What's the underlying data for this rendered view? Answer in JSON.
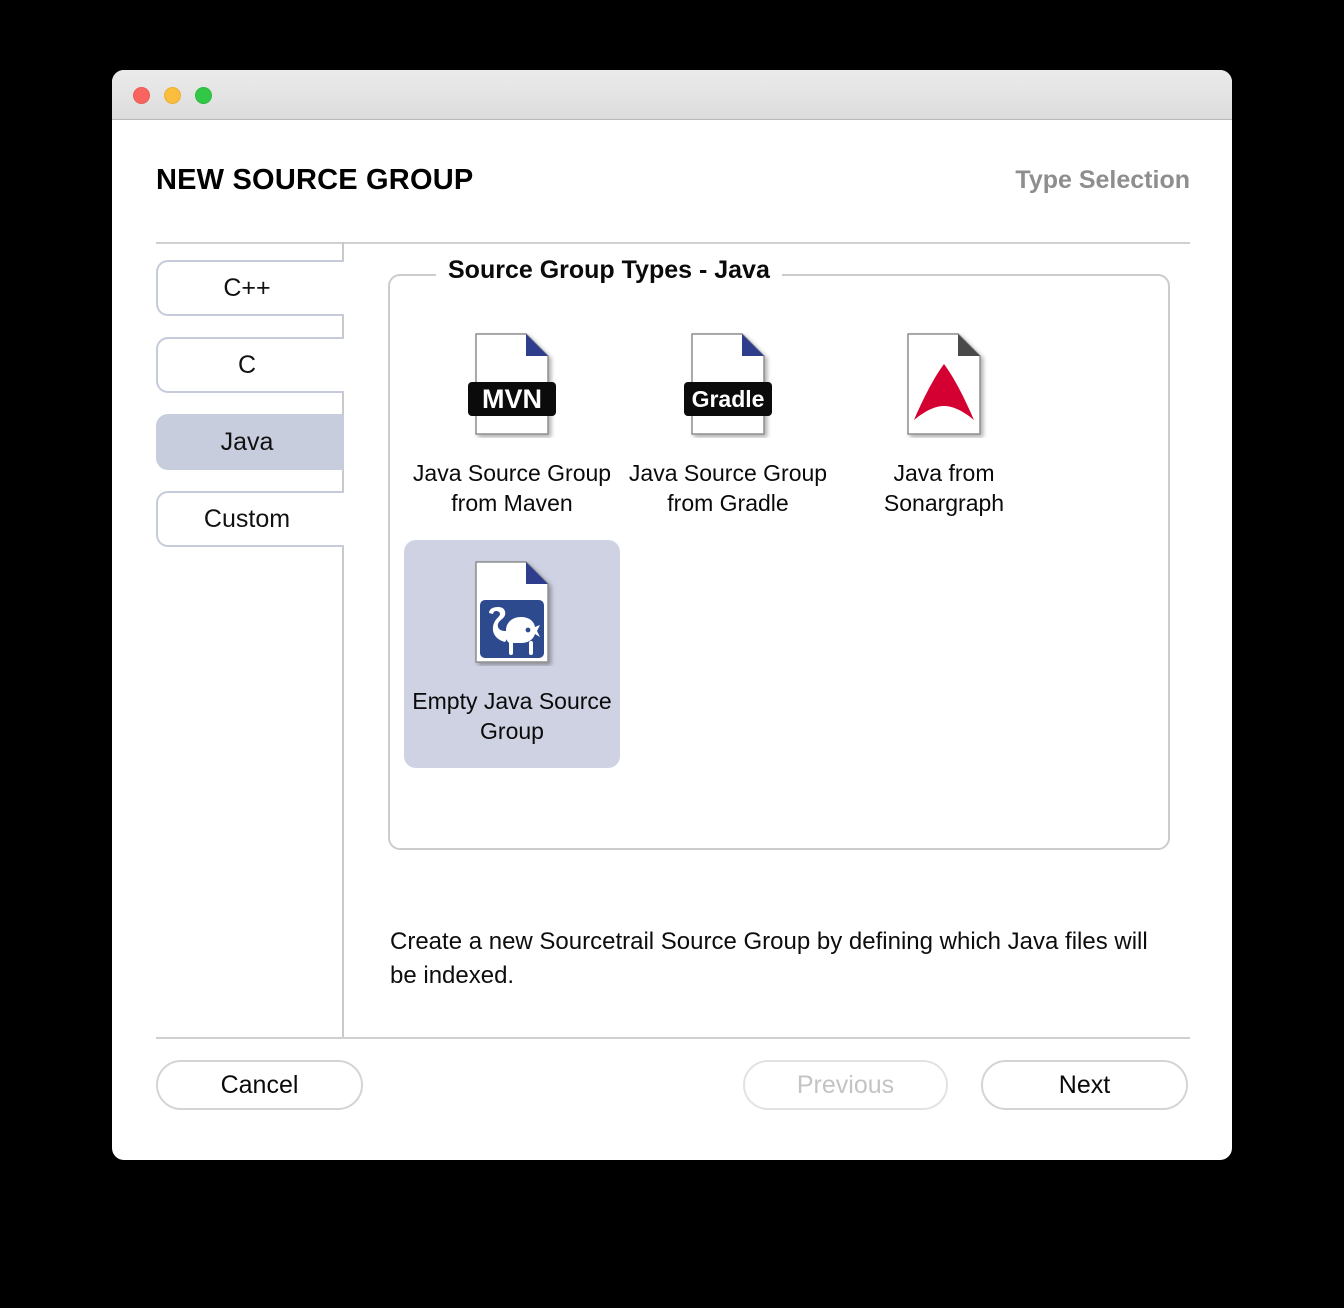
{
  "window": {
    "traffic_lights": [
      {
        "name": "close",
        "color": "#f9655e"
      },
      {
        "name": "minimize",
        "color": "#fbbd3d"
      },
      {
        "name": "maximize",
        "color": "#32c746"
      }
    ]
  },
  "header": {
    "title": "NEW SOURCE GROUP",
    "subtitle": "Type Selection"
  },
  "sidebar": {
    "items": [
      {
        "label": "C++",
        "selected": false
      },
      {
        "label": "C",
        "selected": false
      },
      {
        "label": "Java",
        "selected": true
      },
      {
        "label": "Custom",
        "selected": false
      }
    ]
  },
  "main": {
    "groupbox_title": "Source Group Types - Java",
    "tiles": [
      {
        "label": "Java Source Group from Maven",
        "icon": "maven-document-icon",
        "icon_text": "MVN",
        "selected": false
      },
      {
        "label": "Java Source Group from Gradle",
        "icon": "gradle-document-icon",
        "icon_text": "Gradle",
        "selected": false
      },
      {
        "label": "Java from Sonargraph",
        "icon": "sonargraph-document-icon",
        "icon_text": "",
        "selected": false
      },
      {
        "label": "Empty Java Source Group",
        "icon": "java-document-icon",
        "icon_text": "",
        "selected": true
      }
    ],
    "description": "Create a new Sourcetrail Source Group by defining which Java files will be indexed."
  },
  "footer": {
    "cancel_label": "Cancel",
    "previous_label": "Previous",
    "next_label": "Next"
  },
  "colors": {
    "selected_tab": "#c8cddd",
    "selected_tile": "#ced2e2",
    "subtitle": "#8e8e8e",
    "fold_blue": "#2e3c8c",
    "fold_gray": "#4a4a4a",
    "sonargraph_red": "#d50032",
    "java_blue": "#2e4a8f"
  }
}
